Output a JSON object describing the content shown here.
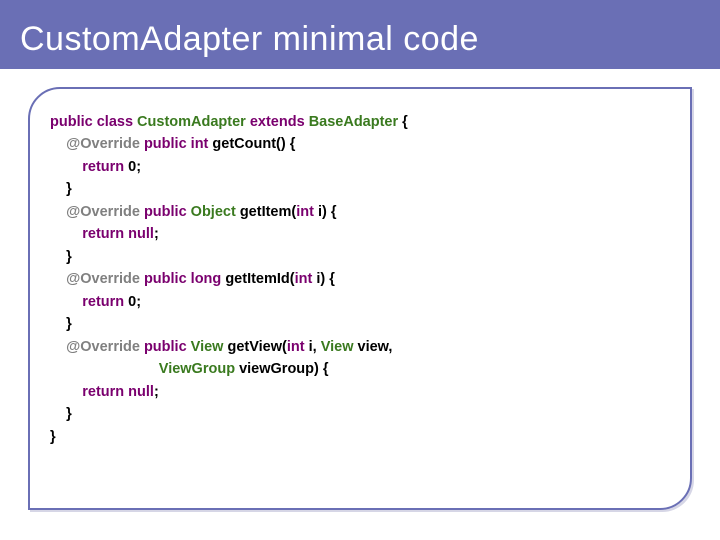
{
  "slide": {
    "title": "CustomAdapter minimal code"
  },
  "code": {
    "l1": {
      "a": "public class ",
      "b": "CustomAdapter ",
      "c": "extends ",
      "d": "BaseAdapter ",
      "e": "{"
    },
    "l2": {
      "a": "    ",
      "b": "@Override ",
      "c": "public ",
      "d": "int ",
      "e": "getCount() {"
    },
    "l3": {
      "a": "        ",
      "b": "return ",
      "c": "0;"
    },
    "l4": {
      "a": "    }"
    },
    "l5": {
      "a": "    ",
      "b": "@Override ",
      "c": "public ",
      "d": "Object ",
      "e": "getItem(",
      "f": "int ",
      "g": "i) {"
    },
    "l6": {
      "a": "        ",
      "b": "return ",
      "c": "null",
      "d": ";"
    },
    "l7": {
      "a": "    }"
    },
    "l8": {
      "a": "    ",
      "b": "@Override ",
      "c": "public ",
      "d": "long ",
      "e": "getItemId(",
      "f": "int ",
      "g": "i) {"
    },
    "l9": {
      "a": "        ",
      "b": "return ",
      "c": "0;"
    },
    "l10": {
      "a": "    }"
    },
    "l11": {
      "a": "    ",
      "b": "@Override ",
      "c": "public ",
      "d": "View ",
      "e": "getView(",
      "f": "int ",
      "g": "i, ",
      "h": "View ",
      "i": "view,"
    },
    "l12": {
      "a": "                           ",
      "b": "ViewGroup ",
      "c": "viewGroup) {"
    },
    "l13": {
      "a": "        ",
      "b": "return ",
      "c": "null",
      "d": ";"
    },
    "l14": {
      "a": "    }"
    },
    "l15": {
      "a": "}"
    }
  }
}
